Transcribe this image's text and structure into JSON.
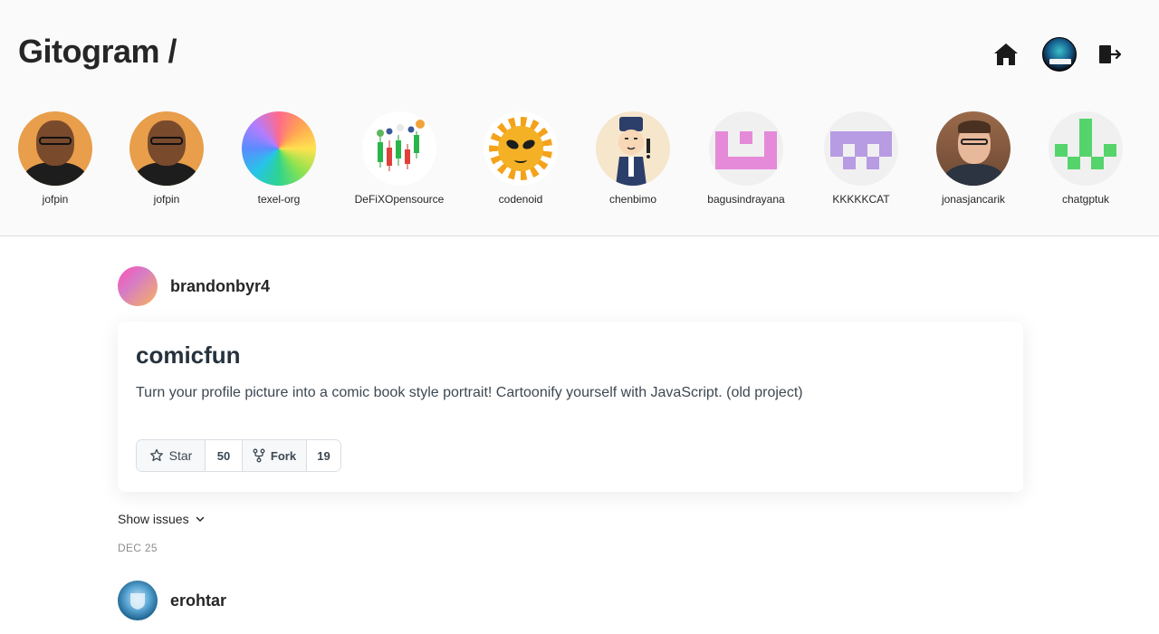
{
  "header": {
    "logo": "Gitogram /",
    "nav": {
      "home_icon": "home-icon",
      "logout_icon": "logout-icon"
    }
  },
  "stories": [
    {
      "name": "jofpin"
    },
    {
      "name": "jofpin"
    },
    {
      "name": "texel-org"
    },
    {
      "name": "DeFiXOpensource"
    },
    {
      "name": "codenoid"
    },
    {
      "name": "chenbimo"
    },
    {
      "name": "bagusindrayana"
    },
    {
      "name": "KKKKKCAT"
    },
    {
      "name": "jonasjancarik"
    },
    {
      "name": "chatgptuk"
    }
  ],
  "feed": {
    "posts": [
      {
        "username": "brandonbyr4",
        "repo": {
          "title": "comicfun",
          "description": "Turn your profile picture into a comic book style portrait! Cartoonify yourself with JavaScript. (old project)",
          "star_label": "Star",
          "stars": "50",
          "fork_label": "Fork",
          "forks": "19"
        },
        "show_issues": "Show issues",
        "date": "DEC 25"
      },
      {
        "username": "erohtar"
      }
    ]
  },
  "colors": {
    "topbar_bg": "#fafafa",
    "text": "#262626",
    "date": "#8e8e8e",
    "pixel_pink": "#e58ad9",
    "pixel_purple": "#b79be3",
    "pixel_green": "#55d46b"
  }
}
